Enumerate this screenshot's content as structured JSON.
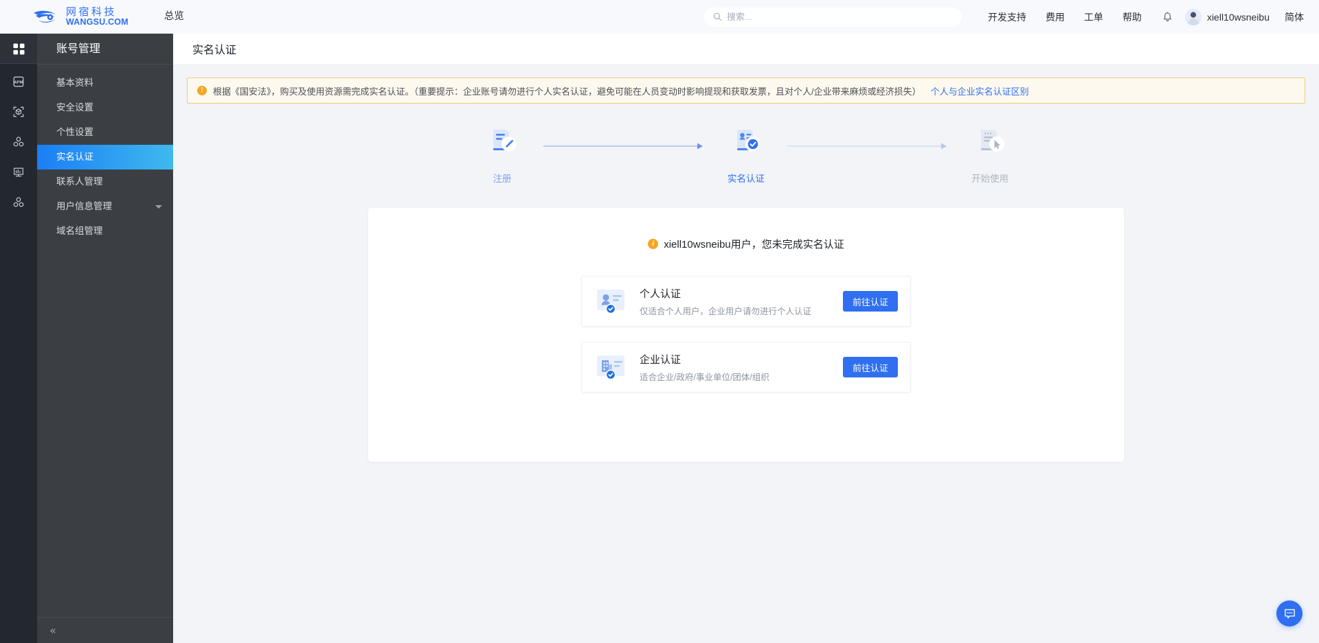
{
  "header": {
    "logo_cn": "网宿科技",
    "logo_en": "WANGSU.COM",
    "overview_label": "总览",
    "search_placeholder": "搜索...",
    "search_value": "",
    "nav_links": [
      {
        "label": "开发支持"
      },
      {
        "label": "费用"
      },
      {
        "label": "工单"
      },
      {
        "label": "帮助"
      }
    ],
    "user_name": "xiell10wsneibu",
    "lang_label": "简体"
  },
  "icon_rail": {
    "items": [
      {
        "name": "dashboard-grid-icon",
        "active": true
      },
      {
        "name": "apm-icon",
        "active": false
      },
      {
        "name": "cube-scan-icon",
        "active": false
      },
      {
        "name": "nodes-cluster-icon",
        "active": false
      },
      {
        "name": "monitor-chart-icon",
        "active": false
      },
      {
        "name": "nodes-cluster-2-icon",
        "active": false
      }
    ]
  },
  "sidebar": {
    "title": "账号管理",
    "items": [
      {
        "label": "基本资料",
        "active": false,
        "has_caret": false
      },
      {
        "label": "安全设置",
        "active": false,
        "has_caret": false
      },
      {
        "label": "个性设置",
        "active": false,
        "has_caret": false
      },
      {
        "label": "实名认证",
        "active": true,
        "has_caret": false
      },
      {
        "label": "联系人管理",
        "active": false,
        "has_caret": false
      },
      {
        "label": "用户信息管理",
        "active": false,
        "has_caret": true
      },
      {
        "label": "域名组管理",
        "active": false,
        "has_caret": false
      }
    ],
    "collapse_glyph": "«"
  },
  "page": {
    "title": "实名认证"
  },
  "banner": {
    "icon_char": "!",
    "text": "根据《国安法》，购买及使用资源需完成实名认证。（重要提示：企业账号请勿进行个人实名认证，避免可能在人员变动时影响提现和获取发票，且对个人/企业带来麻烦或经济损失）",
    "link_label": "个人与企业实名认证区别"
  },
  "stepper": {
    "steps": [
      {
        "label": "注册",
        "state": "done",
        "icon": "register-doc-pencil-icon"
      },
      {
        "label": "实名认证",
        "state": "current",
        "icon": "id-card-check-icon"
      },
      {
        "label": "开始使用",
        "state": "todo",
        "icon": "screen-cursor-icon"
      }
    ]
  },
  "main_card": {
    "notice_icon_char": "i",
    "notice_text": "xiell10wsneibu用户，您未完成实名认证",
    "options": [
      {
        "icon": "person-id-badge-icon",
        "title": "个人认证",
        "desc": "仅适合个人用户，企业用户请勿进行个人认证",
        "button_label": "前往认证"
      },
      {
        "icon": "company-building-badge-icon",
        "title": "企业认证",
        "desc": "适合企业/政府/事业单位/团体/组织",
        "button_label": "前往认证"
      }
    ]
  },
  "chat_fab": {
    "name": "chat-bubble-icon"
  },
  "colors": {
    "brand_blue": "#2f6ff0",
    "sidebar_bg": "#3b3f44",
    "rail_bg": "#23272e",
    "active_menu_from": "#1a7ef5",
    "active_menu_to": "#3fb9ef",
    "warn_bg": "#fdf9ef",
    "warn_border": "#f0c97a",
    "warn_orange": "#f5a623",
    "page_bg": "#f2f4f8"
  }
}
